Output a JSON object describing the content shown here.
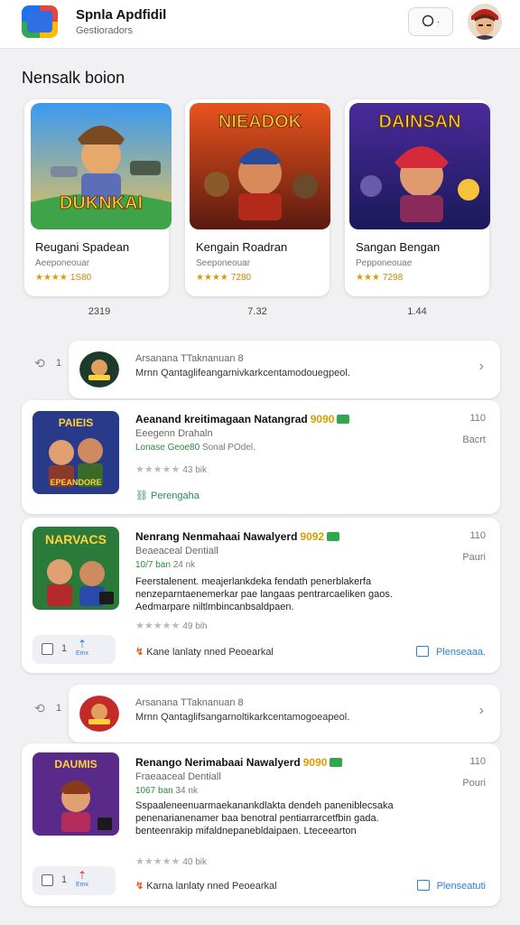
{
  "header": {
    "title": "Spnla Apdfidil",
    "subtitle": "Gestioradors",
    "chat_label": "·",
    "logo_icon": "app-logo-icon",
    "avatar_icon": "user-avatar"
  },
  "section": {
    "title": "Nensalk boion"
  },
  "featured": [
    {
      "art_title": "DUKNKAI",
      "name": "Reugani Spadean",
      "developer": "Aeeponeouar",
      "stars": "★★★★",
      "score": "1S80",
      "count": "2319"
    },
    {
      "art_title": "NIEADOK",
      "name": "Kengain Roadran",
      "developer": "Seeponeouar",
      "stars": "★★★★",
      "score": "7280",
      "count": "7.32"
    },
    {
      "art_title": "DAINSAN",
      "name": "Sangan Bengan",
      "developer": "Pepponeouae",
      "stars": "★★★",
      "score": "7298",
      "count": "1.44"
    }
  ],
  "recommendations": [
    {
      "count": "1",
      "line1": "Arsanana TTaknanuan 8",
      "line2": "Mrnn Qantaglifeangarnivkarkcentamodouegpeol."
    },
    {
      "count": "1",
      "line1": "Arsanana TTaknanuan 8",
      "line2": "Mrnn Qantaglifsangarnoltikarkcentamogoeapeol."
    }
  ],
  "apps": [
    {
      "name": "Aeanand kreitimagaan Natangrad",
      "year": "9090",
      "subtitle": "Eeegenn Drahaln",
      "meta_main": "Lonase Geoe80",
      "meta_muted": "Sonal POdel.",
      "stars": "★★★★★",
      "downloads": "43 bik",
      "footer_link": "Perengaha",
      "count": "110",
      "action": "Bacrt",
      "thumb_title": "PAIEIS",
      "thumb_caption": "EPEANDORE"
    },
    {
      "name": "Nenrang Nenmahaai Nawalyerd",
      "year": "9092",
      "subtitle": "Beaeaceal Dentiall",
      "meta_main": "10/7 ban",
      "meta_muted": "24 nk",
      "description": "Feerstalenent. meajerlankdeka fendath penerblakerfa nenzeparntaenemerkar pae langaas pentrarcaeliken gaos. Aedmarpare niltlmbincanbsaldpaen.",
      "stars": "★★★★★",
      "downloads": "49 bih",
      "like_count": "1",
      "like_label": "Emx",
      "reply_text": "Kane lanlaty nned Peoearkal",
      "share_text": "Plenseaaa.",
      "count": "110",
      "action": "Pauri",
      "thumb_title": "NARVACS"
    },
    {
      "name": "Renango Nerimabaai Nawalyerd",
      "year": "9090",
      "subtitle": "Fraeaaceal Dentiall",
      "meta_main": "1067 ban",
      "meta_muted": "34 nk",
      "description": "Sspaaleneenuarmaekanankdlakta dendeh paneniblecsaka penenarianenamer baa benotral pentiarrarcetfbin gada. benteenrakip mifaldnepanebldaipaen. Lteceearton",
      "stars": "★★★★★",
      "downloads": "40 bik",
      "like_count": "1",
      "like_label": "Emx",
      "reply_text": "Karna lanlaty nned Peoearkal",
      "share_text": "Plenseatuti",
      "count": "110",
      "action": "Pouri",
      "thumb_title": "DAUMIS"
    }
  ],
  "colors": {
    "accent": "#2a7fd6",
    "rating": "#d69e00",
    "green": "#2a8a3a"
  }
}
